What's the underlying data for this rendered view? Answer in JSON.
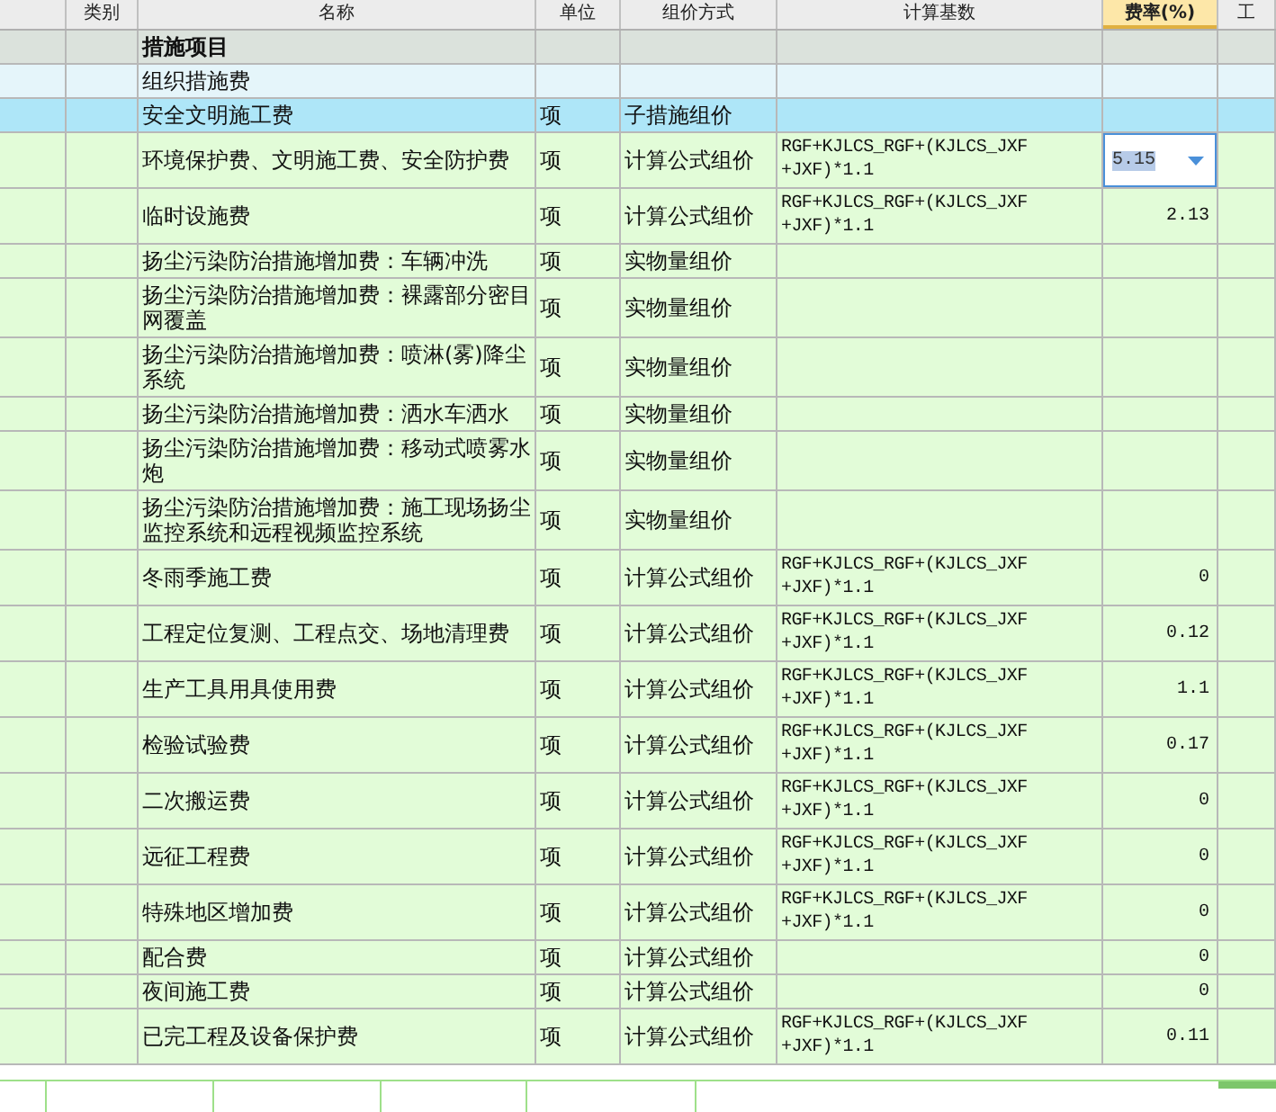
{
  "columns": [
    {},
    {
      "label": "类别"
    },
    {
      "label": "名称"
    },
    {
      "label": "单位"
    },
    {
      "label": "组价方式"
    },
    {
      "label": "计算基数"
    },
    {
      "label": "费率(%)",
      "selected": true
    },
    {
      "label": "工",
      "selected": false
    }
  ],
  "rows": [
    {
      "kind": "heading",
      "selected": false,
      "name": "措施项目"
    },
    {
      "kind": "category",
      "selected": false,
      "name": "组织措施费"
    },
    {
      "kind": "item",
      "selected": true,
      "name": "安全文明施工费",
      "unit": "项",
      "method": "子措施组价"
    },
    {
      "kind": "item",
      "selected": false,
      "name": "环境保护费、文明施工费、安全防护费",
      "unit": "项",
      "method": "计算公式组价",
      "base": "RGF+KJLCS_RGF+(KJLCS_JXF +JXF)*1.1",
      "rate": {
        "text": "5.15",
        "editing": true
      }
    },
    {
      "kind": "item",
      "selected": false,
      "name": "临时设施费",
      "unit": "项",
      "method": "计算公式组价",
      "base": "RGF+KJLCS_RGF+(KJLCS_JXF +JXF)*1.1",
      "rate": {
        "text": "2.13",
        "editing": false
      }
    },
    {
      "kind": "item",
      "selected": false,
      "name": "扬尘污染防治措施增加费：车辆冲洗",
      "unit": "项",
      "method": "实物量组价"
    },
    {
      "kind": "item",
      "selected": false,
      "name": "扬尘污染防治措施增加费：裸露部分密目网覆盖",
      "unit": "项",
      "method": "实物量组价"
    },
    {
      "kind": "item",
      "selected": false,
      "name": "扬尘污染防治措施增加费：喷淋(雾)降尘系统",
      "unit": "项",
      "method": "实物量组价"
    },
    {
      "kind": "item",
      "selected": false,
      "name": "扬尘污染防治措施增加费：洒水车洒水",
      "unit": "项",
      "method": "实物量组价"
    },
    {
      "kind": "item",
      "selected": false,
      "name": "扬尘污染防治措施增加费：移动式喷雾水炮",
      "unit": "项",
      "method": "实物量组价"
    },
    {
      "kind": "item",
      "selected": false,
      "name": "扬尘污染防治措施增加费：施工现场扬尘监控系统和远程视频监控系统",
      "unit": "项",
      "method": "实物量组价"
    },
    {
      "kind": "item",
      "selected": false,
      "name": "冬雨季施工费",
      "unit": "项",
      "method": "计算公式组价",
      "base": "RGF+KJLCS_RGF+(KJLCS_JXF +JXF)*1.1",
      "rate": {
        "text": "0",
        "editing": false
      }
    },
    {
      "kind": "item",
      "selected": false,
      "name": "工程定位复测、工程点交、场地清理费",
      "unit": "项",
      "method": "计算公式组价",
      "base": "RGF+KJLCS_RGF+(KJLCS_JXF +JXF)*1.1",
      "rate": {
        "text": "0.12",
        "editing": false
      }
    },
    {
      "kind": "item",
      "selected": false,
      "name": "生产工具用具使用费",
      "unit": "项",
      "method": "计算公式组价",
      "base": "RGF+KJLCS_RGF+(KJLCS_JXF +JXF)*1.1",
      "rate": {
        "text": "1.1",
        "editing": false
      }
    },
    {
      "kind": "item",
      "selected": false,
      "name": "检验试验费",
      "unit": "项",
      "method": "计算公式组价",
      "base": "RGF+KJLCS_RGF+(KJLCS_JXF +JXF)*1.1",
      "rate": {
        "text": "0.17",
        "editing": false
      }
    },
    {
      "kind": "item",
      "selected": false,
      "name": "二次搬运费",
      "unit": "项",
      "method": "计算公式组价",
      "base": "RGF+KJLCS_RGF+(KJLCS_JXF +JXF)*1.1",
      "rate": {
        "text": "0",
        "editing": false
      }
    },
    {
      "kind": "item",
      "selected": false,
      "name": "远征工程费",
      "unit": "项",
      "method": "计算公式组价",
      "base": "RGF+KJLCS_RGF+(KJLCS_JXF +JXF)*1.1",
      "rate": {
        "text": "0",
        "editing": false
      }
    },
    {
      "kind": "item",
      "selected": false,
      "name": "特殊地区增加费",
      "unit": "项",
      "method": "计算公式组价",
      "base": "RGF+KJLCS_RGF+(KJLCS_JXF +JXF)*1.1",
      "rate": {
        "text": "0",
        "editing": false
      }
    },
    {
      "kind": "item",
      "selected": false,
      "name": "配合费",
      "unit": "项",
      "method": "计算公式组价",
      "rate": {
        "text": "0",
        "editing": false
      }
    },
    {
      "kind": "item",
      "selected": false,
      "name": "夜间施工费",
      "unit": "项",
      "method": "计算公式组价",
      "rate": {
        "text": "0",
        "editing": false
      }
    },
    {
      "kind": "item",
      "selected": false,
      "name": "已完工程及设备保护费",
      "unit": "项",
      "method": "计算公式组价",
      "base": "RGF+KJLCS_RGF+(KJLCS_JXF +JXF)*1.1",
      "rate": {
        "text": "0.11",
        "editing": false
      }
    }
  ],
  "sheet_tabs": [
    {
      "selected": false
    },
    {
      "selected": false
    },
    {
      "selected": false
    },
    {
      "selected": false
    },
    {
      "selected": false
    }
  ]
}
